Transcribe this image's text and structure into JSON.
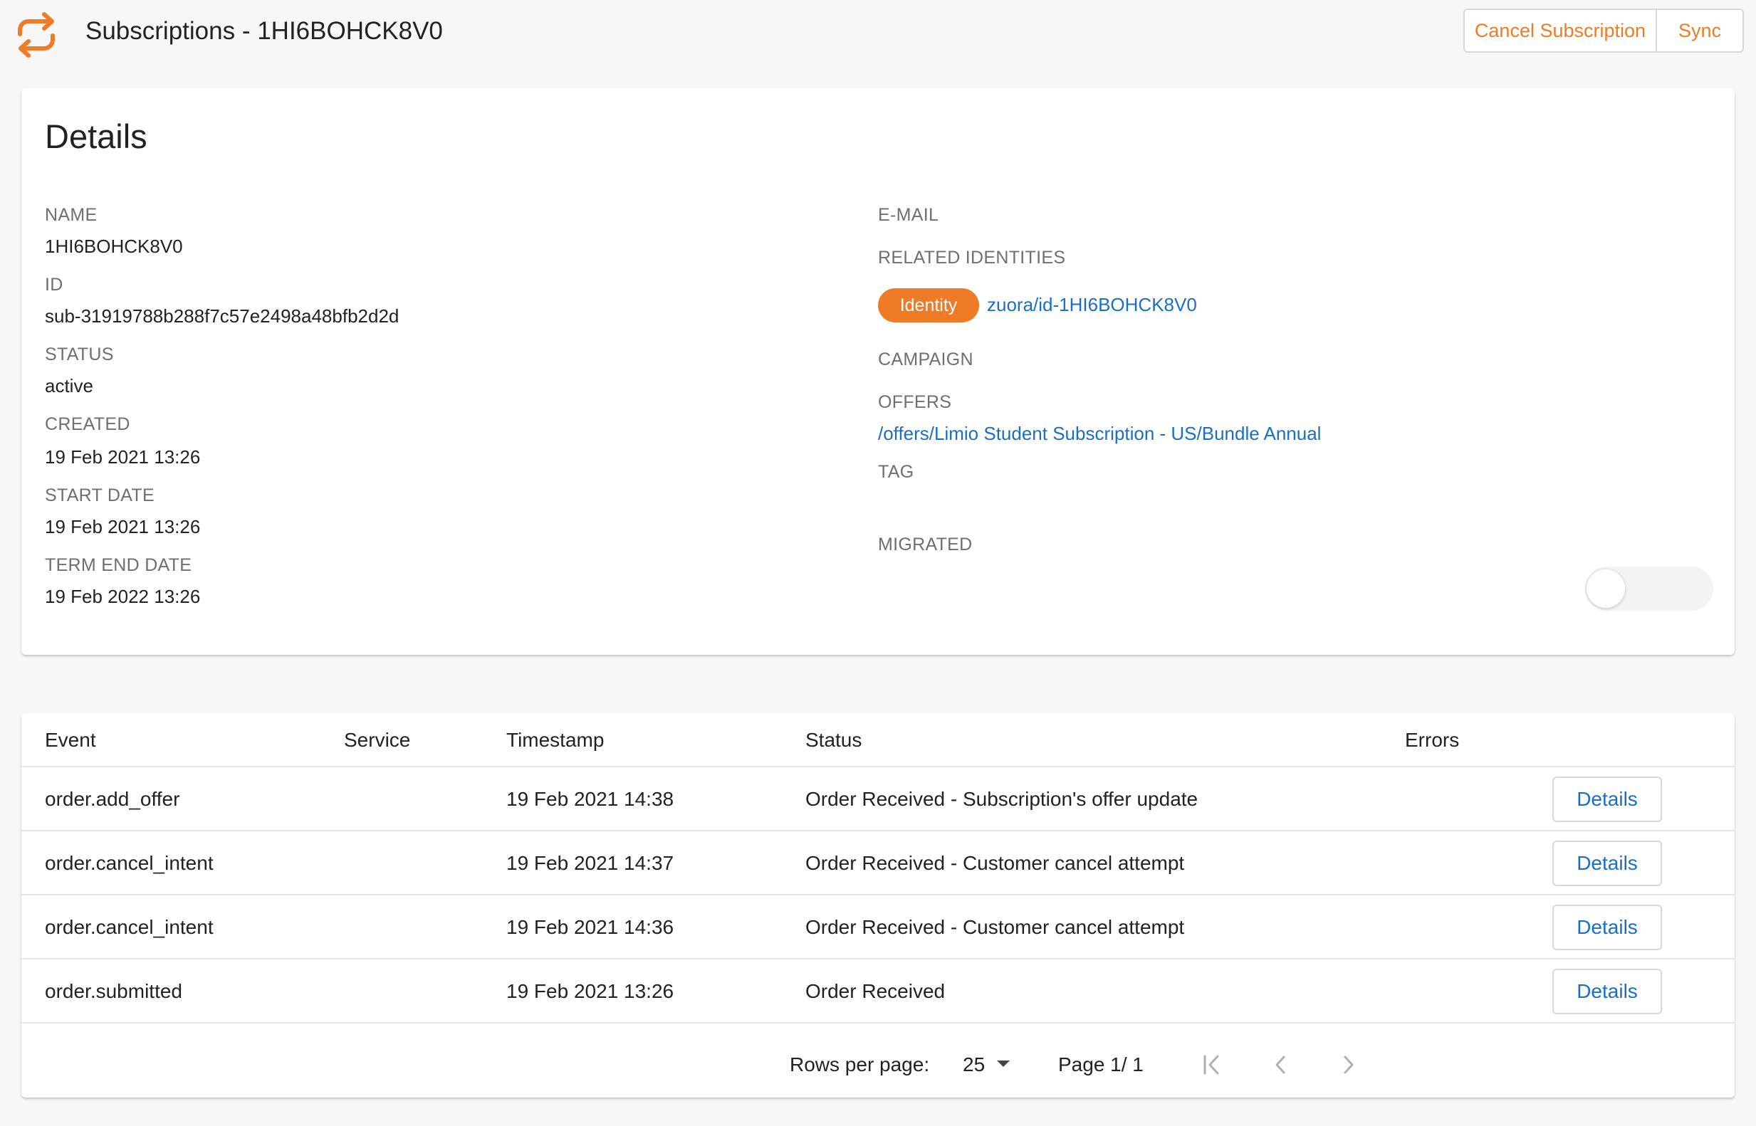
{
  "header": {
    "title": "Subscriptions - 1HI6BOHCK8V0",
    "logo_icon": "sync-arrows-icon",
    "cancel_label": "Cancel Subscription",
    "sync_label": "Sync",
    "accent_color": "#f07b26"
  },
  "details": {
    "heading": "Details",
    "left": [
      {
        "label": "NAME",
        "value": "1HI6BOHCK8V0"
      },
      {
        "label": "ID",
        "value": "sub-31919788b288f7c57e2498a48bfb2d2d"
      },
      {
        "label": "STATUS",
        "value": "active"
      },
      {
        "label": "CREATED",
        "value": "19 Feb 2021 13:26"
      },
      {
        "label": "START DATE",
        "value": "19 Feb 2021 13:26"
      },
      {
        "label": "TERM END DATE",
        "value": "19 Feb 2022 13:26"
      }
    ],
    "email_label": "E-MAIL",
    "related_identities_label": "RELATED IDENTITIES",
    "identity_badge": "Identity",
    "identity_link": "zuora/id-1HI6BOHCK8V0",
    "campaign_label": "CAMPAIGN",
    "offers_label": "OFFERS",
    "offer_link": "/offers/Limio Student Subscription - US/Bundle Annual",
    "tag_label": "TAG",
    "migrated_label": "MIGRATED",
    "migrated_value": false,
    "link_color": "#1a6fc4"
  },
  "events": {
    "columns": [
      "Event",
      "Service",
      "Timestamp",
      "Status",
      "Errors"
    ],
    "details_label": "Details",
    "rows": [
      {
        "event": "order.add_offer",
        "service": "",
        "timestamp": "19 Feb 2021 14:38",
        "status": "Order Received - Subscription's offer update",
        "errors": ""
      },
      {
        "event": "order.cancel_intent",
        "service": "",
        "timestamp": "19 Feb 2021 14:37",
        "status": "Order Received - Customer cancel attempt",
        "errors": ""
      },
      {
        "event": "order.cancel_intent",
        "service": "",
        "timestamp": "19 Feb 2021 14:36",
        "status": "Order Received - Customer cancel attempt",
        "errors": ""
      },
      {
        "event": "order.submitted",
        "service": "",
        "timestamp": "19 Feb 2021 13:26",
        "status": "Order Received",
        "errors": ""
      }
    ]
  },
  "pagination": {
    "rows_per_page_label": "Rows per page:",
    "rows_per_page_value": "25",
    "page_info": "Page 1/ 1",
    "first_icon": "first-page-icon",
    "prev_icon": "chevron-left-icon",
    "next_icon": "chevron-right-icon"
  }
}
